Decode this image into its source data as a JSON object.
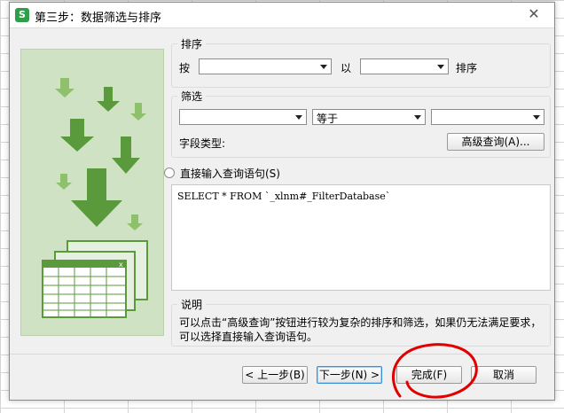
{
  "window": {
    "title": "第三步：数据筛选与排序",
    "app_icon": "S",
    "close": "✕"
  },
  "sort": {
    "group_title": "排序",
    "by_label": "按",
    "then_label": "以",
    "suffix_label": "排序",
    "field_value": "",
    "order_value": ""
  },
  "filter": {
    "group_title": "筛选",
    "field_value": "",
    "operator_value": "等于",
    "criteria_value": "",
    "field_type_label": "字段类型:",
    "advanced_button": "高级查询(A)..."
  },
  "query": {
    "radio_label": "直接输入查询语句(S)",
    "text": "SELECT * FROM `_xlnm#_FilterDatabase`"
  },
  "description": {
    "group_title": "说明",
    "text": "可以点击“高级查询”按钮进行较为复杂的排序和筛选，如果仍无法满足要求，可以选择直接输入查询语句。"
  },
  "footer": {
    "back_button": "< 上一步(B)",
    "next_button": "下一步(N) >",
    "finish_button": "完成(F)",
    "cancel_button": "取消"
  },
  "colors": {
    "illustration_bg": "#cfe3c4",
    "arrow_green": "#5a9a3d",
    "arrow_light": "#8fc06c",
    "annotation_red": "#e00000"
  }
}
